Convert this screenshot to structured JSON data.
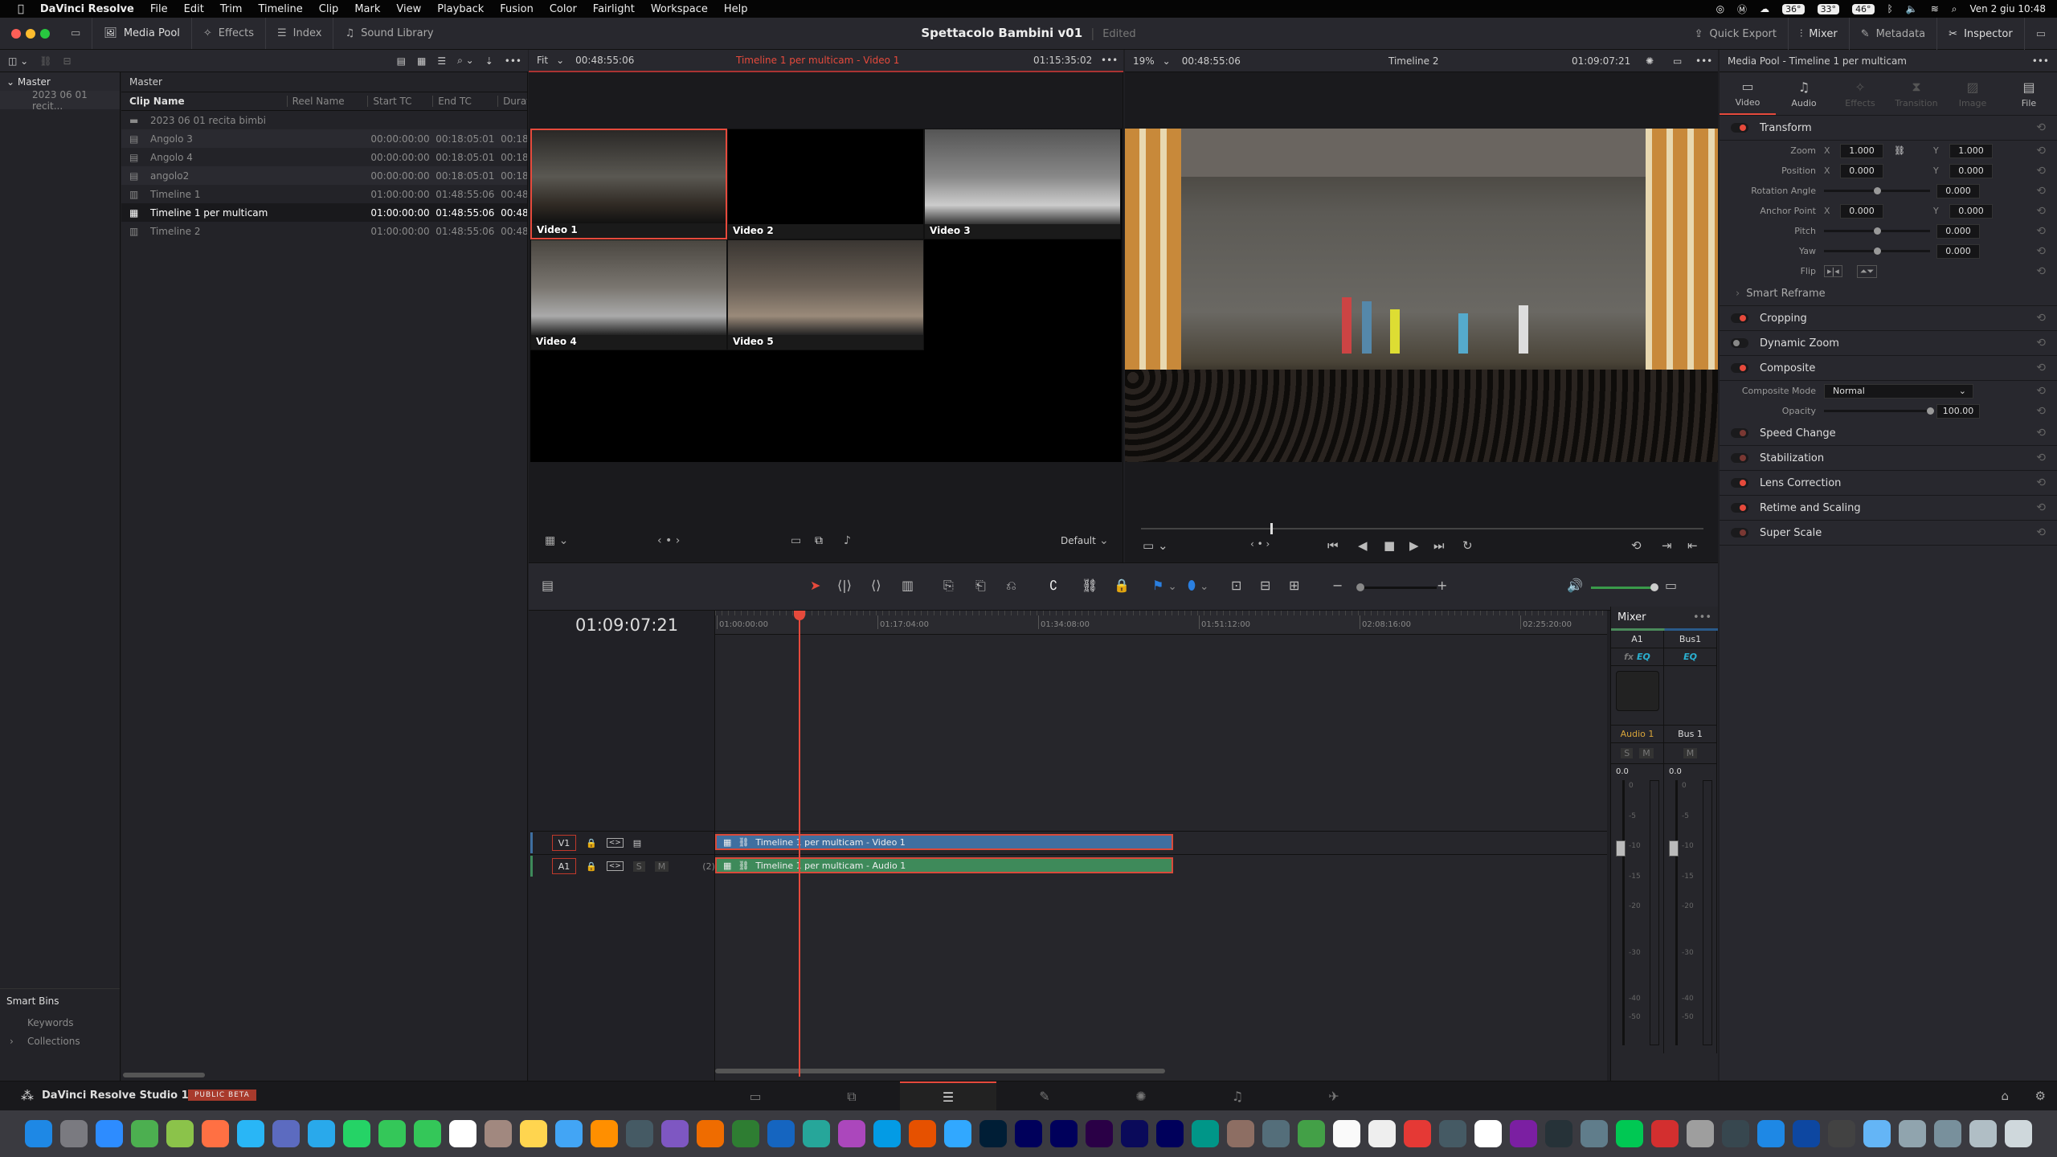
{
  "menubar": {
    "app": "DaVinci Resolve",
    "items": [
      "File",
      "Edit",
      "Trim",
      "Timeline",
      "Clip",
      "Mark",
      "View",
      "Playback",
      "Fusion",
      "Color",
      "Fairlight",
      "Workspace",
      "Help"
    ],
    "status": {
      "temps": [
        "36°",
        "33°",
        "46°"
      ],
      "datetime": "Ven 2 giu  10:48"
    }
  },
  "toolbar": {
    "media_pool": "Media Pool",
    "effects": "Effects",
    "index": "Index",
    "sound_library": "Sound Library",
    "project_title": "Spettacolo Bambini v01",
    "project_state": "Edited",
    "quick_export": "Quick Export",
    "mixer": "Mixer",
    "metadata": "Metadata",
    "inspector": "Inspector"
  },
  "source_viewer": {
    "fit": "Fit",
    "timecode_left": "00:48:55:06",
    "title": "Timeline 1 per multicam - Video 1",
    "timecode_right": "01:15:35:02",
    "angles": [
      "Video 1",
      "Video 2",
      "Video 3",
      "Video 4",
      "Video 5"
    ],
    "active_angle": 0,
    "layout_preset": "Default"
  },
  "program_viewer": {
    "zoom": "19%",
    "timecode_left": "00:48:55:06",
    "title": "Timeline 2",
    "timecode_right": "01:09:07:21",
    "scrub_progress": 0.23
  },
  "bins": {
    "master": "Master",
    "items": [
      "2023 06 01 recit..."
    ],
    "smart_bins": "Smart Bins",
    "smart_items": [
      "Keywords",
      "Collections"
    ]
  },
  "media_pool": {
    "header": "Master",
    "columns": [
      "Clip Name",
      "Reel Name",
      "Start TC",
      "End TC",
      "Durat"
    ],
    "rows": [
      {
        "name": "2023 06 01 recita bimbi",
        "reel": "",
        "start": "",
        "end": "",
        "dur": "",
        "icon": "folder-icon"
      },
      {
        "name": "Angolo 3",
        "reel": "",
        "start": "00:00:00:00",
        "end": "00:18:05:01",
        "dur": "00:18",
        "icon": "clip-icon"
      },
      {
        "name": "Angolo 4",
        "reel": "",
        "start": "00:00:00:00",
        "end": "00:18:05:01",
        "dur": "00:18",
        "icon": "clip-icon"
      },
      {
        "name": "angolo2",
        "reel": "",
        "start": "00:00:00:00",
        "end": "00:18:05:01",
        "dur": "00:18",
        "icon": "clip-icon"
      },
      {
        "name": "Timeline 1",
        "reel": "",
        "start": "01:00:00:00",
        "end": "01:48:55:06",
        "dur": "00:48",
        "icon": "timeline-icon"
      },
      {
        "name": "Timeline 1 per multicam",
        "reel": "",
        "start": "01:00:00:00",
        "end": "01:48:55:06",
        "dur": "00:48",
        "icon": "multicam-icon",
        "selected": true
      },
      {
        "name": "Timeline 2",
        "reel": "",
        "start": "01:00:00:00",
        "end": "01:48:55:06",
        "dur": "00:48",
        "icon": "timeline-icon"
      }
    ]
  },
  "inspector": {
    "title": "Media Pool - Timeline 1 per multicam",
    "tabs": [
      "Video",
      "Audio",
      "Effects",
      "Transition",
      "Image",
      "File"
    ],
    "active_tab": 0,
    "transform": {
      "label": "Transform",
      "zoom": "Zoom",
      "zoom_x": "1.000",
      "zoom_y": "1.000",
      "position": "Position",
      "pos_x": "0.000",
      "pos_y": "0.000",
      "rotation": "Rotation Angle",
      "rotation_val": "0.000",
      "anchor": "Anchor Point",
      "anchor_x": "0.000",
      "anchor_y": "0.000",
      "pitch": "Pitch",
      "pitch_val": "0.000",
      "yaw": "Yaw",
      "yaw_val": "0.000",
      "flip": "Flip",
      "x": "X",
      "y": "Y"
    },
    "smart_reframe": "Smart Reframe",
    "cropping": "Cropping",
    "dynamic_zoom": "Dynamic Zoom",
    "composite": {
      "label": "Composite",
      "mode_label": "Composite Mode",
      "mode": "Normal",
      "opacity_label": "Opacity",
      "opacity": "100.00"
    },
    "sections": [
      "Speed Change",
      "Stabilization",
      "Lens Correction",
      "Retime and Scaling",
      "Super Scale"
    ]
  },
  "timeline": {
    "timecode": "01:09:07:21",
    "ruler": [
      "01:00:00:00",
      "01:17:04:00",
      "01:34:08:00",
      "01:51:12:00",
      "02:08:16:00",
      "02:25:20:00"
    ],
    "tracks": [
      {
        "id": "V1",
        "clip": "Timeline 1 per multicam - Video 1",
        "color": "#3f6fa0"
      },
      {
        "id": "A1",
        "clip": "Timeline 1 per multicam - Audio 1",
        "color": "#3e8a5a",
        "count": "(2)"
      }
    ],
    "solo": "S",
    "mute": "M"
  },
  "mixer": {
    "title": "Mixer",
    "channels": [
      {
        "id": "A1",
        "name": "Audio 1",
        "level": "0.0"
      },
      {
        "id": "Bus1",
        "name": "Bus 1",
        "level": "0.0"
      }
    ],
    "fx": "fx",
    "eq": "EQ",
    "scale": [
      "0",
      "-5",
      "-10",
      "-15",
      "-20",
      "-30",
      "-40",
      "-50"
    ]
  },
  "footer": {
    "product": "DaVinci Resolve Studio 18.5",
    "badge": "PUBLIC BETA"
  },
  "colors": {
    "accent": "#e64a3c",
    "video_clip": "#3f6fa0",
    "audio_clip": "#3e8a5a",
    "badge": "#a83a2c"
  },
  "dock": [
    "finder",
    "launchpad",
    "zoom",
    "app",
    "app",
    "firefox",
    "safari",
    "app",
    "telegram",
    "whatsapp",
    "messages",
    "facetime",
    "calendar",
    "app",
    "notes",
    "app",
    "vlc",
    "davinci",
    "app",
    "app",
    "app",
    "app",
    "app",
    "app",
    "app",
    "app",
    "lightroom-classic",
    "photoshop",
    "audition",
    "animate",
    "premiere",
    "media-encoder",
    "after-effects",
    "app",
    "app",
    "app",
    "app",
    "app",
    "app",
    "app",
    "app",
    "app",
    "app",
    "app",
    "app",
    "app",
    "app",
    "app",
    "app",
    "app",
    "app",
    "app",
    "app",
    "app",
    "app",
    "app",
    "trash"
  ]
}
